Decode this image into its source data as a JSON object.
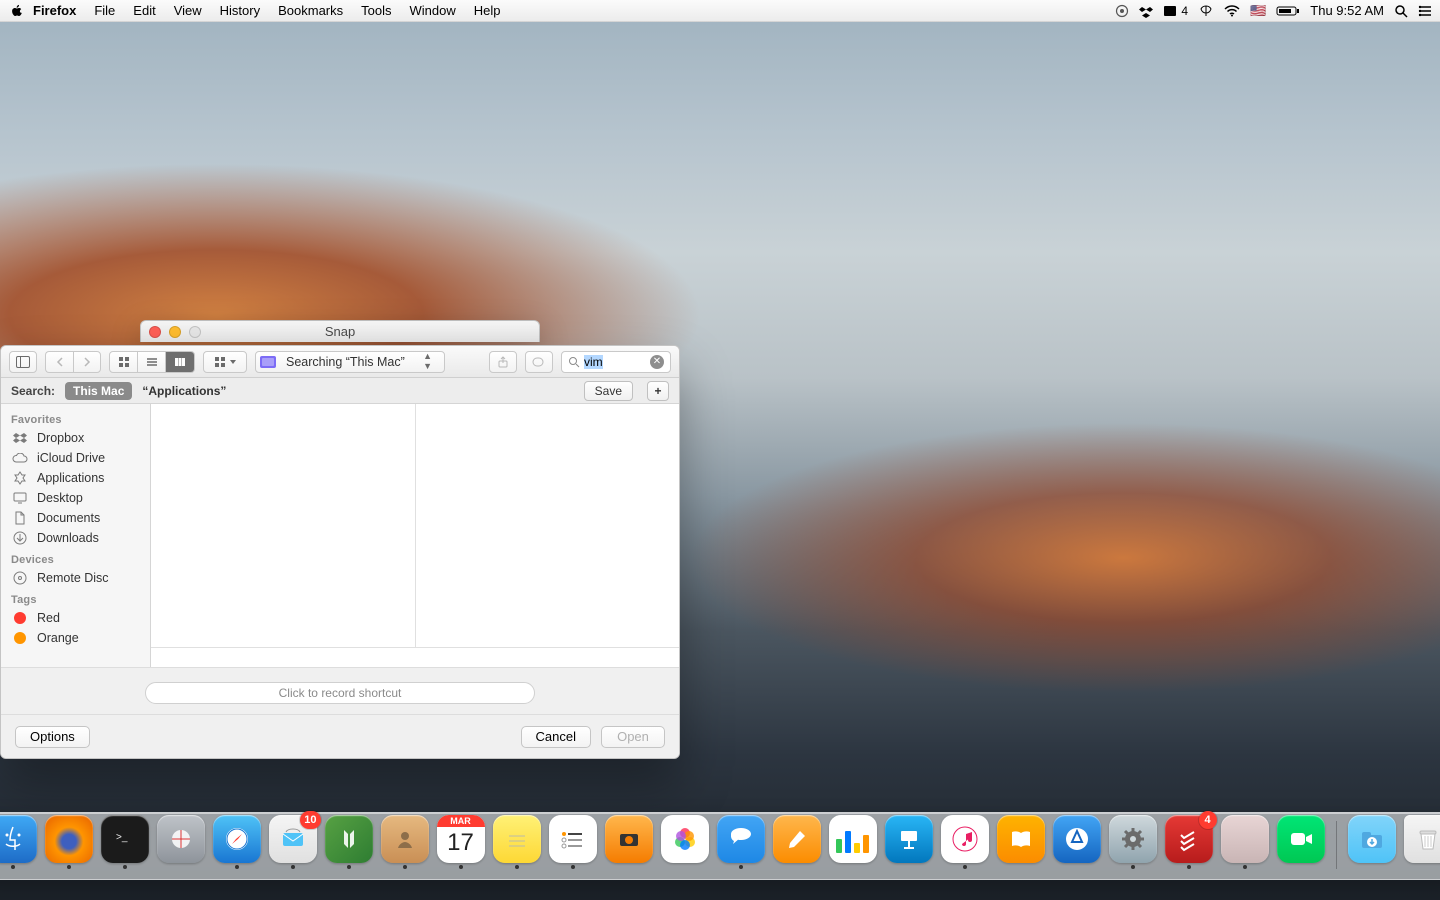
{
  "menubar": {
    "app_name": "Firefox",
    "items": [
      "File",
      "Edit",
      "View",
      "History",
      "Bookmarks",
      "Tools",
      "Window",
      "Help"
    ],
    "status": {
      "fantastical_badge": "4",
      "clock": "Thu 9:52 AM",
      "flag": "🇺🇸"
    }
  },
  "snap_window": {
    "title": "Snap"
  },
  "dialog": {
    "location_label": "Searching “This Mac”",
    "search_value": "vim",
    "scope": {
      "label": "Search:",
      "selected": "This Mac",
      "alt": "“Applications”",
      "save": "Save",
      "add": "+"
    },
    "sidebar": {
      "sections": [
        {
          "title": "Favorites",
          "items": [
            "Dropbox",
            "iCloud Drive",
            "Applications",
            "Desktop",
            "Documents",
            "Downloads"
          ]
        },
        {
          "title": "Devices",
          "items": [
            "Remote Disc"
          ]
        },
        {
          "title": "Tags",
          "items": [
            "Red",
            "Orange"
          ]
        }
      ]
    },
    "shortcut_placeholder": "Click to record shortcut",
    "buttons": {
      "options": "Options",
      "cancel": "Cancel",
      "open": "Open"
    }
  },
  "dock": {
    "calendar": {
      "month": "MAR",
      "day": "17"
    },
    "apps": [
      {
        "name": "finder",
        "running": true
      },
      {
        "name": "firefox",
        "running": true
      },
      {
        "name": "terminal",
        "running": true
      },
      {
        "name": "launchpad",
        "running": false
      },
      {
        "name": "safari",
        "running": true
      },
      {
        "name": "mail",
        "running": true,
        "badge": "10"
      },
      {
        "name": "neovim",
        "running": true
      },
      {
        "name": "contacts",
        "running": true
      },
      {
        "name": "calendar",
        "running": true
      },
      {
        "name": "notes",
        "running": true
      },
      {
        "name": "reminders",
        "running": true
      },
      {
        "name": "photobooth",
        "running": false
      },
      {
        "name": "photos",
        "running": false
      },
      {
        "name": "messages",
        "running": true
      },
      {
        "name": "pages",
        "running": false
      },
      {
        "name": "numbers",
        "running": false
      },
      {
        "name": "keynote",
        "running": false
      },
      {
        "name": "itunes",
        "running": true
      },
      {
        "name": "ibooks",
        "running": false
      },
      {
        "name": "appstore",
        "running": false
      },
      {
        "name": "preferences",
        "running": true
      },
      {
        "name": "todoist",
        "running": true,
        "badge": "4"
      },
      {
        "name": "snap",
        "running": true
      },
      {
        "name": "facetime",
        "running": false
      }
    ]
  }
}
